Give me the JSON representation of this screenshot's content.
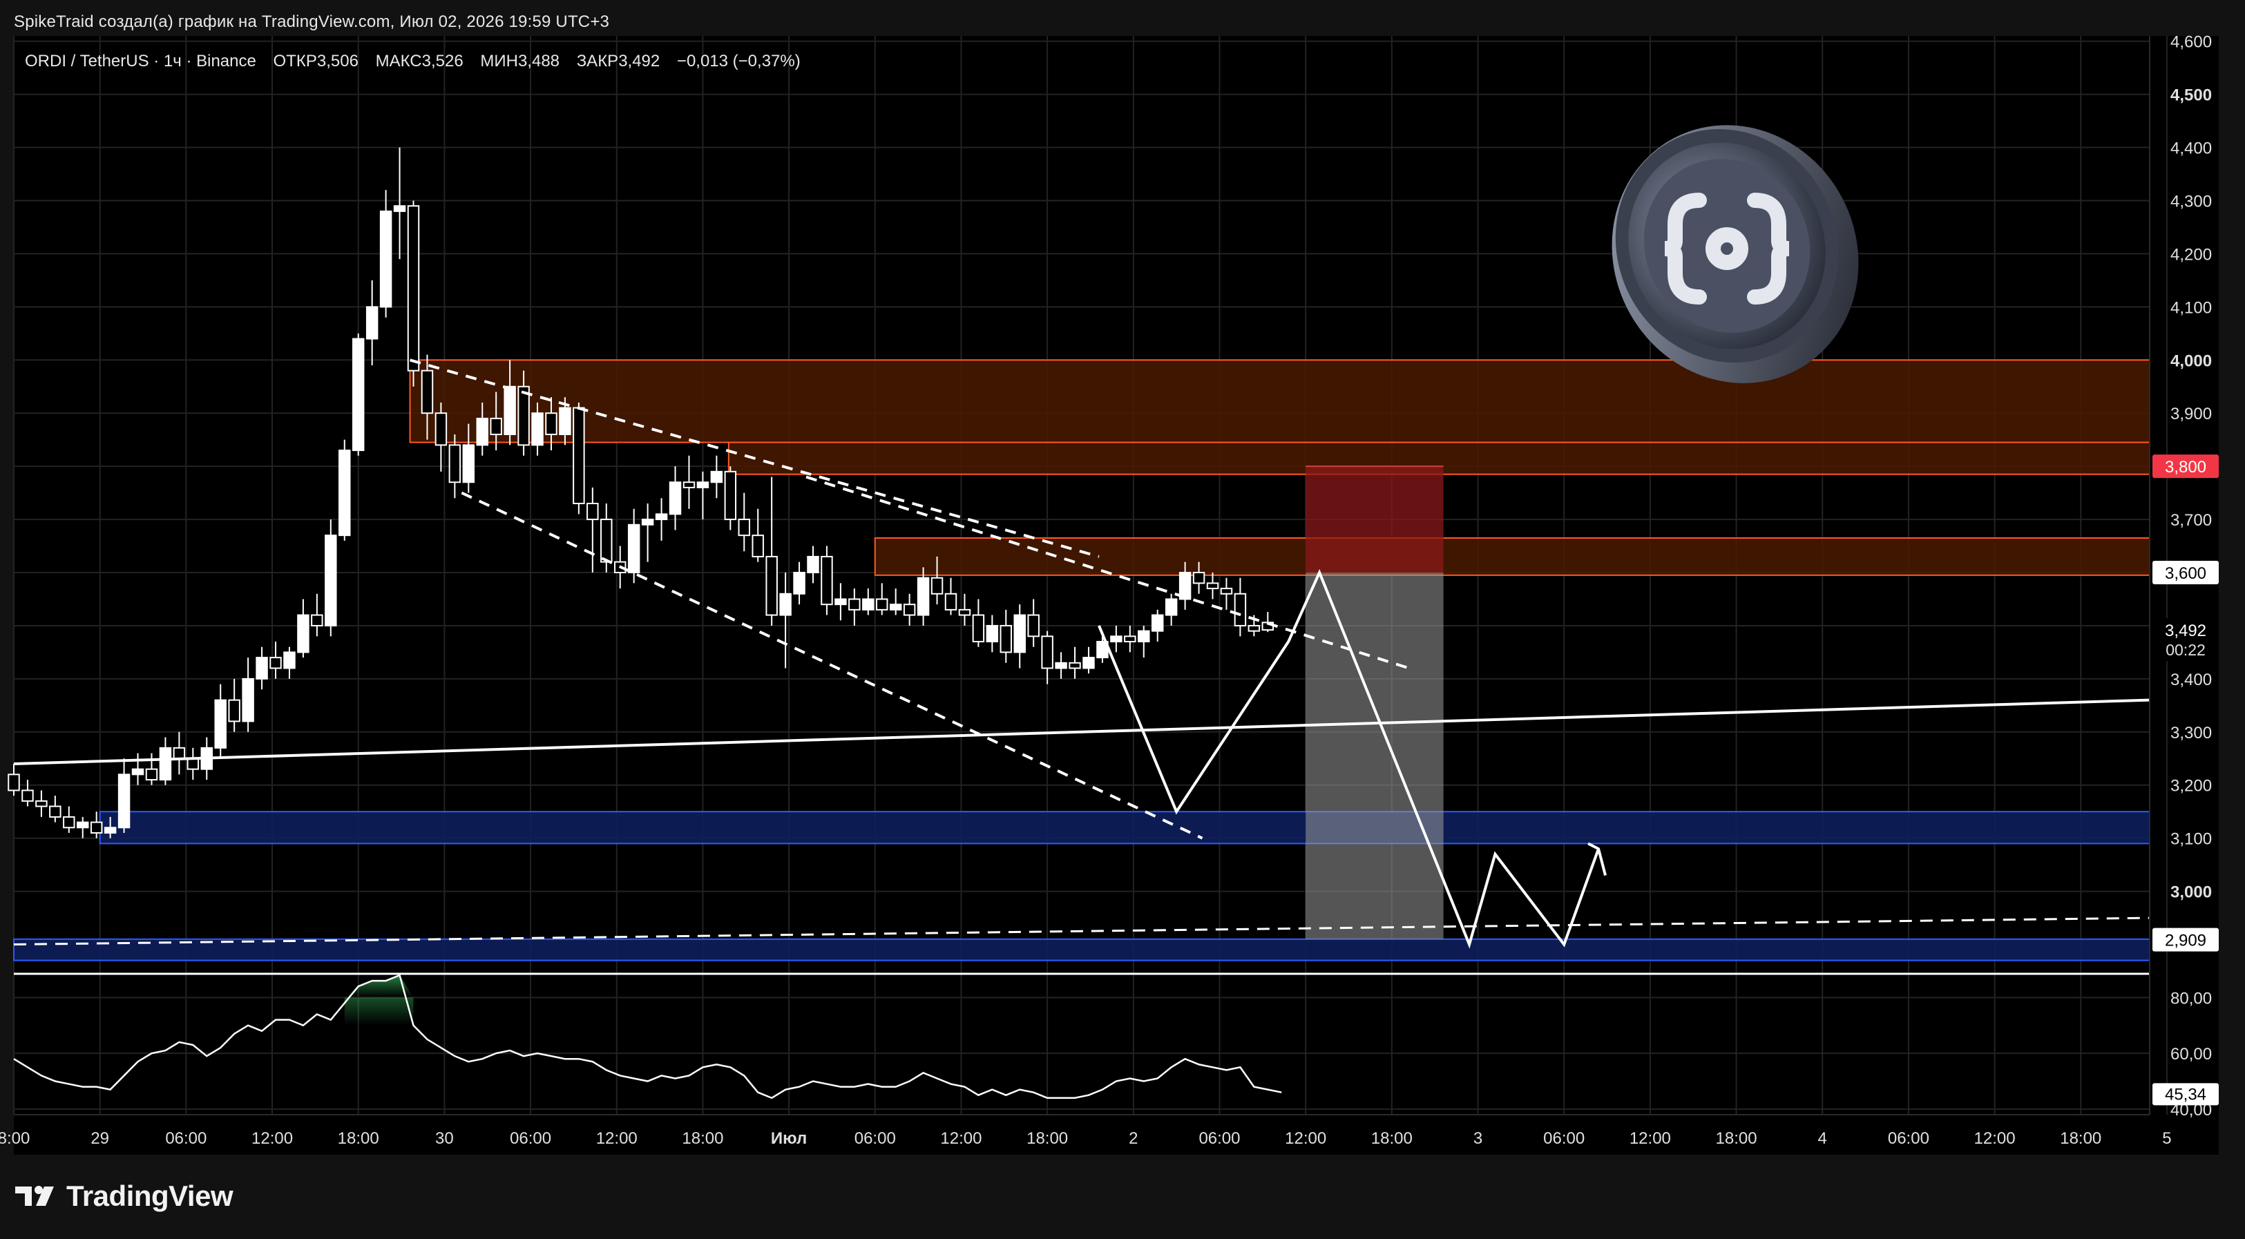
{
  "header": {
    "publisher_text": "SpikeTraid создал(а) график на TradingView.com, Июл 02, 2026 19:59 UTC+3"
  },
  "legend": {
    "symbol": "ORDI / TetherUS · 1ч · Binance",
    "open_label": "ОТКР",
    "open": "3,506",
    "high_label": "МАКС",
    "high": "3,526",
    "low_label": "МИН",
    "low": "3,488",
    "close_label": "ЗАКР",
    "close": "3,492",
    "change": "−0,013 (−0,37%)"
  },
  "brand": {
    "name": "TradingView",
    "icon": "tradingview-logo-icon"
  },
  "coin_icon": "ordinals-coin-icon",
  "colors": {
    "background": "#000000",
    "frame": "#121212",
    "grid": "#232323",
    "candle": "#ffffff",
    "resistance_fill": "#4a1a00",
    "resistance_border": "#ff5a1f",
    "support_fill": "#0d1f5c",
    "support_border": "#2d5bff",
    "risk_zone": "#8b1a1a",
    "reward_zone": "#9a9a9a",
    "price_tag_red": "#f23645",
    "rsi_overbought_fill": "#1f7a3a"
  },
  "chart_data": {
    "type": "candlestick",
    "symbol": "ORDI / TetherUS",
    "interval": "1ч",
    "ylim": [
      2.85,
      4.61
    ],
    "y_ticks": [
      "4,600",
      "4,500",
      "4,400",
      "4,300",
      "4,200",
      "4,100",
      "4,000",
      "3,900",
      "3,800",
      "3,700",
      "3,600",
      "3,500",
      "3,400",
      "3,300",
      "3,200",
      "3,100",
      "3,000"
    ],
    "y_tick_values": [
      4.6,
      4.5,
      4.4,
      4.3,
      4.2,
      4.1,
      4.0,
      3.9,
      3.8,
      3.7,
      3.6,
      3.5,
      3.4,
      3.3,
      3.2,
      3.1,
      3.0
    ],
    "y_tick_bold": [
      "4,500",
      "4,000",
      "3,000"
    ],
    "x_range_hours": [
      -16,
      108
    ],
    "x_ticks": [
      {
        "label": "8:00",
        "h": -16
      },
      {
        "label": "29",
        "h": -11
      },
      {
        "label": "06:00",
        "h": -6
      },
      {
        "label": "12:00",
        "h": -1
      },
      {
        "label": "18:00",
        "h": 4
      },
      {
        "label": "30",
        "h": 9
      },
      {
        "label": "06:00",
        "h": 14
      },
      {
        "label": "12:00",
        "h": 19
      },
      {
        "label": "18:00",
        "h": 24
      },
      {
        "label": "Июл",
        "h": 29,
        "bold": true
      },
      {
        "label": "06:00",
        "h": 34
      },
      {
        "label": "12:00",
        "h": 39
      },
      {
        "label": "18:00",
        "h": 44
      },
      {
        "label": "2",
        "h": 49
      },
      {
        "label": "06:00",
        "h": 54
      },
      {
        "label": "12:00",
        "h": 59
      },
      {
        "label": "18:00",
        "h": 64
      },
      {
        "label": "3",
        "h": 69
      },
      {
        "label": "06:00",
        "h": 74
      },
      {
        "label": "12:00",
        "h": 79
      },
      {
        "label": "18:00",
        "h": 84
      },
      {
        "label": "4",
        "h": 89
      },
      {
        "label": "06:00",
        "h": 94
      },
      {
        "label": "12:00",
        "h": 99
      },
      {
        "label": "18:00",
        "h": 104
      },
      {
        "label": "5",
        "h": 109
      }
    ],
    "candles_ohlc": [
      [
        3.22,
        3.24,
        3.18,
        3.19
      ],
      [
        3.19,
        3.21,
        3.16,
        3.17
      ],
      [
        3.17,
        3.19,
        3.14,
        3.16
      ],
      [
        3.16,
        3.18,
        3.13,
        3.14
      ],
      [
        3.14,
        3.16,
        3.11,
        3.12
      ],
      [
        3.12,
        3.14,
        3.1,
        3.13
      ],
      [
        3.13,
        3.15,
        3.1,
        3.11
      ],
      [
        3.11,
        3.14,
        3.1,
        3.12
      ],
      [
        3.12,
        3.25,
        3.11,
        3.22
      ],
      [
        3.22,
        3.26,
        3.2,
        3.23
      ],
      [
        3.23,
        3.26,
        3.2,
        3.21
      ],
      [
        3.21,
        3.29,
        3.2,
        3.27
      ],
      [
        3.27,
        3.3,
        3.22,
        3.25
      ],
      [
        3.25,
        3.27,
        3.21,
        3.23
      ],
      [
        3.23,
        3.29,
        3.21,
        3.27
      ],
      [
        3.27,
        3.39,
        3.25,
        3.36
      ],
      [
        3.36,
        3.4,
        3.3,
        3.32
      ],
      [
        3.32,
        3.44,
        3.3,
        3.4
      ],
      [
        3.4,
        3.46,
        3.38,
        3.44
      ],
      [
        3.44,
        3.47,
        3.4,
        3.42
      ],
      [
        3.42,
        3.46,
        3.4,
        3.45
      ],
      [
        3.45,
        3.55,
        3.44,
        3.52
      ],
      [
        3.52,
        3.56,
        3.48,
        3.5
      ],
      [
        3.5,
        3.7,
        3.48,
        3.67
      ],
      [
        3.67,
        3.85,
        3.66,
        3.83
      ],
      [
        3.83,
        4.05,
        3.82,
        4.04
      ],
      [
        4.04,
        4.15,
        3.99,
        4.1
      ],
      [
        4.1,
        4.32,
        4.08,
        4.28
      ],
      [
        4.28,
        4.4,
        4.19,
        4.29
      ],
      [
        4.29,
        4.3,
        3.95,
        3.98
      ],
      [
        3.98,
        4.01,
        3.85,
        3.9
      ],
      [
        3.9,
        3.92,
        3.79,
        3.84
      ],
      [
        3.84,
        3.86,
        3.74,
        3.77
      ],
      [
        3.77,
        3.88,
        3.75,
        3.84
      ],
      [
        3.84,
        3.92,
        3.82,
        3.89
      ],
      [
        3.89,
        3.94,
        3.83,
        3.86
      ],
      [
        3.86,
        4.0,
        3.84,
        3.95
      ],
      [
        3.95,
        3.98,
        3.82,
        3.84
      ],
      [
        3.84,
        3.92,
        3.82,
        3.9
      ],
      [
        3.9,
        3.93,
        3.83,
        3.86
      ],
      [
        3.86,
        3.93,
        3.84,
        3.91
      ],
      [
        3.91,
        3.92,
        3.71,
        3.73
      ],
      [
        3.73,
        3.76,
        3.6,
        3.7
      ],
      [
        3.7,
        3.73,
        3.6,
        3.62
      ],
      [
        3.62,
        3.65,
        3.57,
        3.6
      ],
      [
        3.6,
        3.72,
        3.58,
        3.69
      ],
      [
        3.69,
        3.73,
        3.62,
        3.7
      ],
      [
        3.7,
        3.74,
        3.66,
        3.71
      ],
      [
        3.71,
        3.8,
        3.68,
        3.77
      ],
      [
        3.77,
        3.82,
        3.72,
        3.76
      ],
      [
        3.76,
        3.79,
        3.7,
        3.77
      ],
      [
        3.77,
        3.82,
        3.74,
        3.79
      ],
      [
        3.79,
        3.8,
        3.68,
        3.7
      ],
      [
        3.7,
        3.75,
        3.64,
        3.67
      ],
      [
        3.67,
        3.72,
        3.62,
        3.63
      ],
      [
        3.63,
        3.78,
        3.5,
        3.52
      ],
      [
        3.52,
        3.6,
        3.42,
        3.56
      ],
      [
        3.56,
        3.62,
        3.54,
        3.6
      ],
      [
        3.6,
        3.65,
        3.58,
        3.63
      ],
      [
        3.63,
        3.65,
        3.52,
        3.54
      ],
      [
        3.54,
        3.58,
        3.51,
        3.55
      ],
      [
        3.55,
        3.57,
        3.5,
        3.53
      ],
      [
        3.53,
        3.57,
        3.52,
        3.55
      ],
      [
        3.55,
        3.58,
        3.52,
        3.53
      ],
      [
        3.53,
        3.57,
        3.52,
        3.54
      ],
      [
        3.54,
        3.56,
        3.5,
        3.52
      ],
      [
        3.52,
        3.61,
        3.5,
        3.59
      ],
      [
        3.59,
        3.63,
        3.54,
        3.56
      ],
      [
        3.56,
        3.59,
        3.52,
        3.53
      ],
      [
        3.53,
        3.56,
        3.5,
        3.52
      ],
      [
        3.52,
        3.55,
        3.46,
        3.47
      ],
      [
        3.47,
        3.52,
        3.45,
        3.5
      ],
      [
        3.5,
        3.53,
        3.43,
        3.45
      ],
      [
        3.45,
        3.54,
        3.42,
        3.52
      ],
      [
        3.52,
        3.55,
        3.46,
        3.48
      ],
      [
        3.48,
        3.49,
        3.39,
        3.42
      ],
      [
        3.42,
        3.45,
        3.4,
        3.43
      ],
      [
        3.43,
        3.46,
        3.4,
        3.42
      ],
      [
        3.42,
        3.46,
        3.41,
        3.44
      ],
      [
        3.44,
        3.48,
        3.43,
        3.47
      ],
      [
        3.47,
        3.5,
        3.45,
        3.48
      ],
      [
        3.48,
        3.5,
        3.45,
        3.47
      ],
      [
        3.47,
        3.5,
        3.44,
        3.49
      ],
      [
        3.49,
        3.53,
        3.47,
        3.52
      ],
      [
        3.52,
        3.56,
        3.5,
        3.55
      ],
      [
        3.55,
        3.62,
        3.53,
        3.6
      ],
      [
        3.6,
        3.62,
        3.56,
        3.58
      ],
      [
        3.58,
        3.6,
        3.55,
        3.57
      ],
      [
        3.57,
        3.59,
        3.53,
        3.56
      ],
      [
        3.56,
        3.59,
        3.48,
        3.5
      ],
      [
        3.5,
        3.52,
        3.48,
        3.49
      ],
      [
        3.506,
        3.526,
        3.488,
        3.492
      ]
    ],
    "horizontal_levels": [
      {
        "label": "3,800",
        "value": 3.8,
        "tag": "red"
      },
      {
        "label": "3,600",
        "value": 3.6,
        "tag": "white"
      },
      {
        "label": "3,492",
        "value": 3.492,
        "tag": "white",
        "countdown": "00:22"
      },
      {
        "label": "2,909",
        "value": 2.909,
        "tag": "white"
      }
    ],
    "rsi": {
      "ylim": [
        38,
        88
      ],
      "ticks": [
        "80,00",
        "60,00",
        "40,00"
      ],
      "tick_values": [
        80,
        60,
        40
      ],
      "current": "45,34",
      "values": [
        58,
        55,
        52,
        50,
        49,
        48,
        48,
        47,
        52,
        57,
        60,
        61,
        64,
        63,
        59,
        62,
        67,
        70,
        68,
        72,
        72,
        70,
        74,
        72,
        78,
        84,
        86,
        86,
        88,
        70,
        65,
        62,
        59,
        57,
        58,
        60,
        61,
        59,
        60,
        59,
        58,
        58,
        57,
        54,
        52,
        51,
        50,
        52,
        51,
        52,
        55,
        56,
        55,
        52,
        46,
        44,
        47,
        48,
        50,
        49,
        48,
        48,
        49,
        48,
        48,
        50,
        53,
        51,
        49,
        48,
        45,
        47,
        45,
        47,
        46,
        44,
        44,
        44,
        45,
        47,
        50,
        51,
        50,
        51,
        55,
        58,
        56,
        55,
        54,
        55,
        48,
        47,
        46
      ]
    }
  }
}
